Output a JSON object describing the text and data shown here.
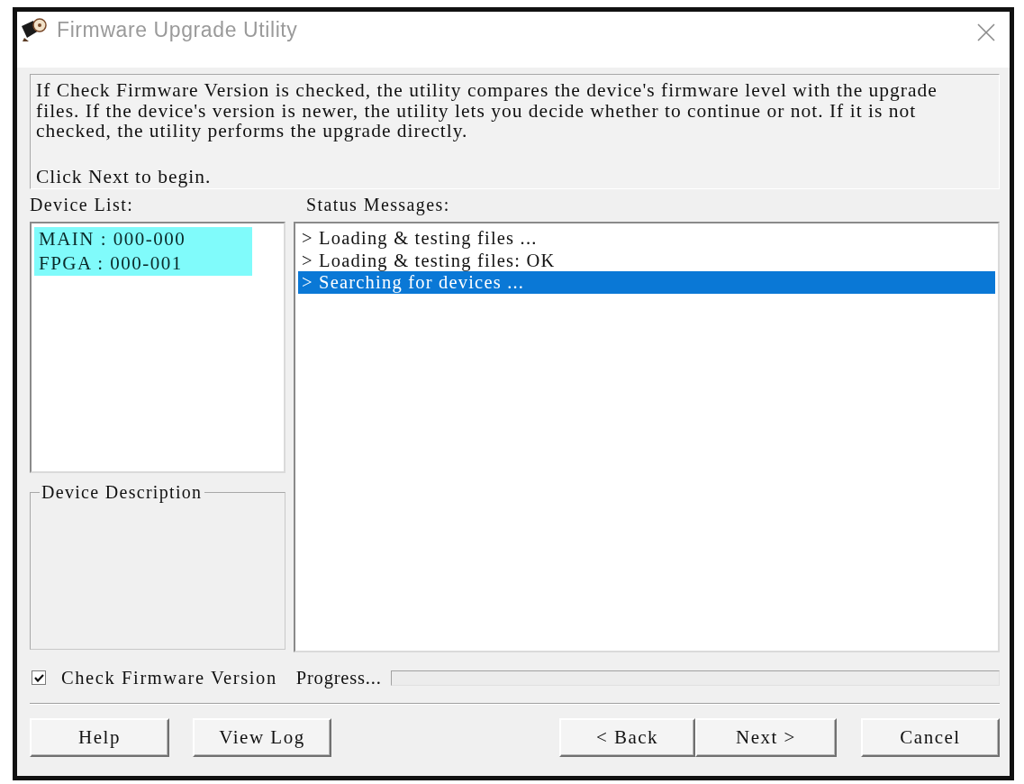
{
  "window": {
    "title": "Firmware Upgrade Utility"
  },
  "intro": {
    "paragraph": "If Check Firmware Version is checked, the utility compares the device's firmware level with the upgrade files. If the device's version is newer, the utility lets you decide whether to continue or not. If it is not checked, the utility performs the upgrade directly.",
    "prompt": "Click Next to begin."
  },
  "device_list": {
    "label": "Device List:",
    "items": [
      {
        "text": "MAIN : 000-000",
        "selected": true
      },
      {
        "text": "FPGA : 000-001",
        "selected": true
      }
    ]
  },
  "device_description": {
    "legend": "Device Description"
  },
  "status_messages": {
    "label": "Status Messages:",
    "items": [
      {
        "text": "> Loading & testing files ...",
        "selected": false
      },
      {
        "text": "> Loading & testing files: OK",
        "selected": false
      },
      {
        "text": "> Searching for devices ...",
        "selected": true
      }
    ]
  },
  "check_firmware_version": {
    "label": "Check Firmware Version",
    "checked": true
  },
  "progress": {
    "label": "Progress..."
  },
  "buttons": {
    "left": [
      "Help",
      "View Log"
    ],
    "wizard": [
      "< Back",
      "Next >"
    ],
    "cancel": "Cancel"
  }
}
